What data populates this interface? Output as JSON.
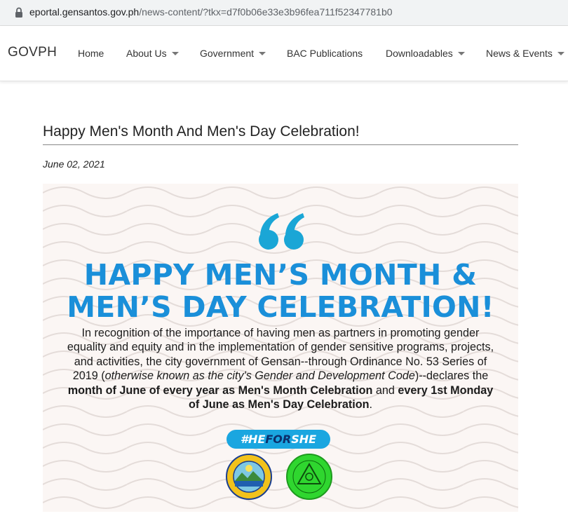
{
  "browser": {
    "url_host": "eportal.gensantos.gov.ph",
    "url_path": "/news-content/?tkx=d7f0b06e33e3b96fea711f52347781b0"
  },
  "nav": {
    "brand": "GOVPH",
    "items": [
      {
        "label": "Home"
      },
      {
        "label": "About Us"
      },
      {
        "label": "Government"
      },
      {
        "label": "BAC Publications"
      },
      {
        "label": "Downloadables"
      },
      {
        "label": "News & Events"
      }
    ]
  },
  "article": {
    "title": "Happy Men's Month And Men's Day Celebration!",
    "date": "June 02, 2021"
  },
  "banner": {
    "headline_line1": "HAPPY MEN’S MONTH &",
    "headline_line2": "MEN’S DAY CELEBRATION!",
    "body_part1": "In recognition of the importance of having men as partners in promoting gender equality and equity and in the implementation of gender sensitive programs, projects, and activities, the city government of Gensan--through Ordinance No. 53 Series of 2019 (",
    "body_italic": "otherwise known as the city's Gender and Development Code",
    "body_part2": ")--declares the ",
    "body_bold1": "month of June of every year as Men's Month Celebration",
    "body_part3": " and ",
    "body_bold2": "every 1st Monday of June as Men's Day Celebration",
    "body_part4": ".",
    "hashtag_he": "#HE",
    "hashtag_for": "FOR",
    "hashtag_she": "SHE",
    "seal1_text": "SEAL OF THE CITY OF GENERAL SANTOS 1968",
    "colors": {
      "headline": "#1a8fd9",
      "hashtag_bg": "#1aa6e0",
      "seal2": "#2fd62f"
    }
  }
}
